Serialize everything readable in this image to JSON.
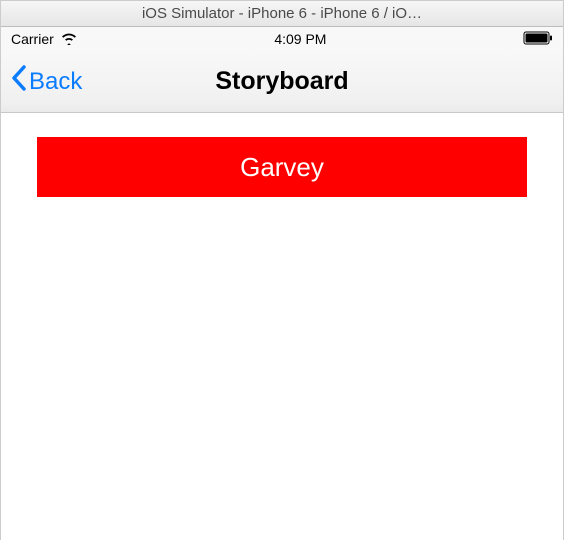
{
  "window": {
    "title": "iOS Simulator - iPhone 6 - iPhone 6 / iO…"
  },
  "status_bar": {
    "carrier": "Carrier",
    "time": "4:09 PM"
  },
  "nav": {
    "back_label": "Back",
    "title": "Storyboard"
  },
  "content": {
    "label_text": "Garvey"
  },
  "colors": {
    "accent": "#0a7cff",
    "label_bg": "#ff0000"
  }
}
